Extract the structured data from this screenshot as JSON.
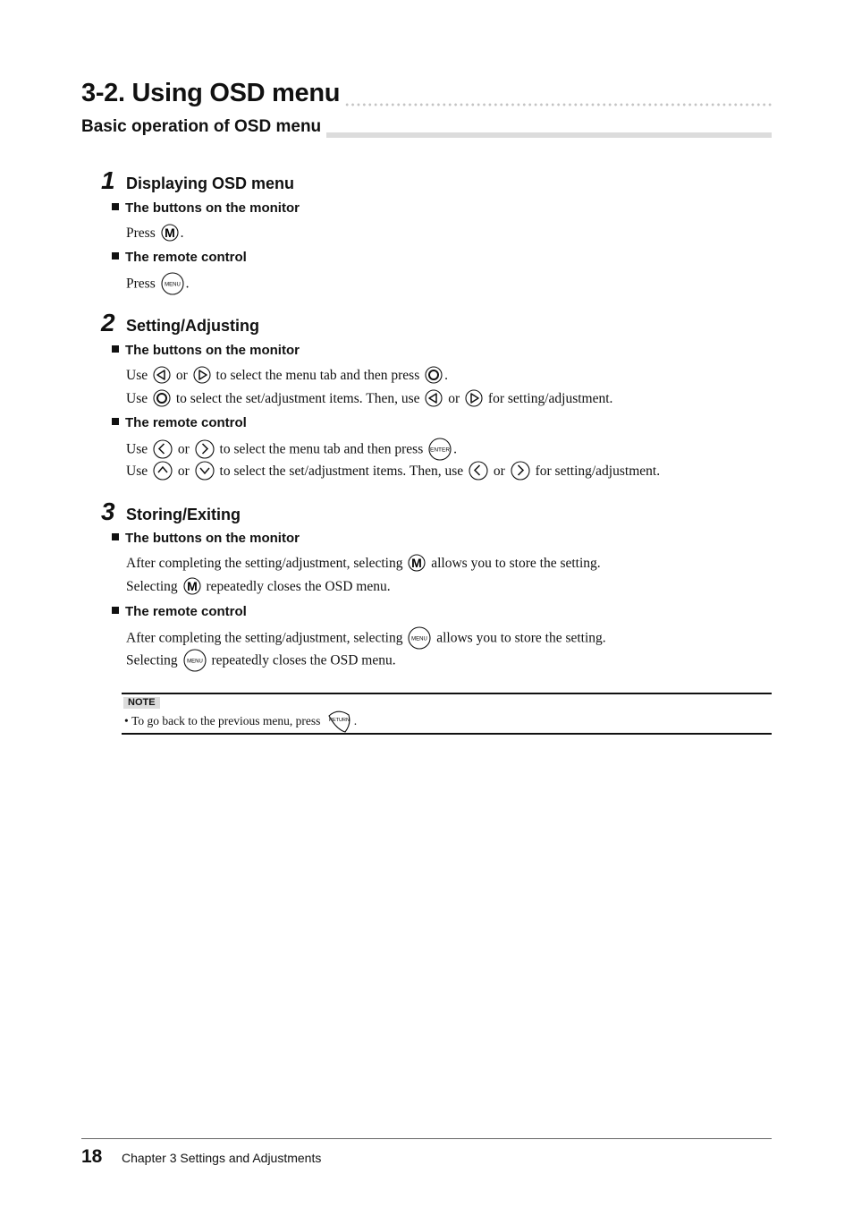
{
  "header": {
    "title": "3-2. Using OSD menu",
    "subtitle": "Basic operation of OSD menu"
  },
  "steps": [
    {
      "number": "1",
      "title": "Displaying OSD menu",
      "sections": [
        {
          "heading": "The buttons on the monitor",
          "lines": [
            {
              "parts": [
                "Press ",
                {
                  "icon": "monitor-menu-m"
                },
                "."
              ]
            }
          ]
        },
        {
          "heading": "The remote control",
          "lines": [
            {
              "parts": [
                "Press ",
                {
                  "icon": "remote-menu"
                },
                "."
              ]
            }
          ]
        }
      ]
    },
    {
      "number": "2",
      "title": "Setting/Adjusting",
      "sections": [
        {
          "heading": "The buttons on the monitor",
          "lines": [
            {
              "parts": [
                "Use ",
                {
                  "icon": "monitor-left"
                },
                " or ",
                {
                  "icon": "monitor-right"
                },
                " to select the menu tab and then press ",
                {
                  "icon": "monitor-enter"
                },
                "."
              ]
            },
            {
              "parts": [
                "Use ",
                {
                  "icon": "monitor-enter"
                },
                " to select the set/adjustment items. Then, use ",
                {
                  "icon": "monitor-left"
                },
                " or ",
                {
                  "icon": "monitor-right"
                },
                " for setting/adjustment."
              ]
            }
          ]
        },
        {
          "heading": "The remote control",
          "lines": [
            {
              "parts": [
                "Use ",
                {
                  "icon": "remote-left"
                },
                " or ",
                {
                  "icon": "remote-right"
                },
                " to select the menu tab and then press ",
                {
                  "icon": "remote-enter"
                },
                "."
              ]
            },
            {
              "parts": [
                "Use ",
                {
                  "icon": "remote-up"
                },
                " or ",
                {
                  "icon": "remote-down"
                },
                " to select the set/adjustment items. Then, use ",
                {
                  "icon": "remote-left"
                },
                " or ",
                {
                  "icon": "remote-right"
                },
                " for setting/adjustment."
              ]
            }
          ]
        }
      ]
    },
    {
      "number": "3",
      "title": "Storing/Exiting",
      "sections": [
        {
          "heading": "The buttons on the monitor",
          "lines": [
            {
              "parts": [
                "After completing the setting/adjustment, selecting ",
                {
                  "icon": "monitor-menu-m"
                },
                " allows you to store the setting."
              ]
            },
            {
              "parts": [
                "Selecting ",
                {
                  "icon": "monitor-menu-m"
                },
                " repeatedly closes the OSD menu."
              ]
            }
          ]
        },
        {
          "heading": "The remote control",
          "lines": [
            {
              "parts": [
                "After completing the setting/adjustment, selecting ",
                {
                  "icon": "remote-menu"
                },
                " allows you to store the setting."
              ]
            },
            {
              "parts": [
                "Selecting ",
                {
                  "icon": "remote-menu"
                },
                " repeatedly closes the OSD menu."
              ]
            }
          ]
        }
      ]
    }
  ],
  "icon_labels": {
    "monitor-menu-m": "M",
    "remote-menu": "MENU",
    "remote-enter": "ENTER",
    "remote-return": "RETURN"
  },
  "note": {
    "label": "NOTE",
    "bullet": "•",
    "parts": [
      "To go back to the previous menu, press ",
      {
        "icon": "remote-return"
      },
      "."
    ]
  },
  "footer": {
    "page_number": "18",
    "chapter": "Chapter 3  Settings and Adjustments"
  }
}
